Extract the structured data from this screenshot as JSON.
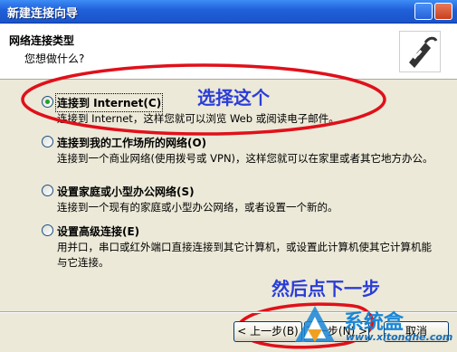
{
  "window": {
    "title": "新建连接向导"
  },
  "header": {
    "title": "网络连接类型",
    "subtitle": "您想做什么?"
  },
  "options": [
    {
      "label": "连接到 Internet(C)",
      "description": "连接到 Internet，这样您就可以浏览 Web 或阅读电子邮件。",
      "checked": true
    },
    {
      "label": "连接到我的工作场所的网络(O)",
      "description": "连接到一个商业网络(使用拨号或 VPN)，这样您就可以在家里或者其它地方办公。",
      "checked": false
    },
    {
      "label": "设置家庭或小型办公网络(S)",
      "description": "连接到一个现有的家庭或小型办公网络，或者设置一个新的。",
      "checked": false
    },
    {
      "label": "设置高级连接(E)",
      "description": "用并口，串口或红外端口直接连接到其它计算机，或设置此计算机使其它计算机能与它连接。",
      "checked": false
    }
  ],
  "annotations": {
    "select_this": "选择这个",
    "then_next": "然后点下一步",
    "color": "#2a3dd8",
    "circle_color": "#e0101a"
  },
  "buttons": {
    "back": "< 上一步(B)",
    "next": "下一步(N) >",
    "cancel": "取消"
  },
  "watermark": {
    "text": "系统盒",
    "url": "www.xitonghe.com"
  }
}
